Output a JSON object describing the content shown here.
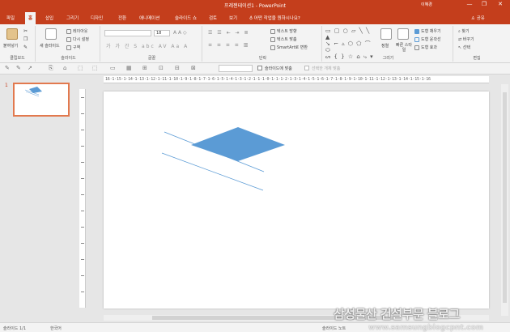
{
  "window": {
    "title": "프레젠테이션1 - PowerPoint",
    "user": "이혜경",
    "minimize": "—",
    "restore": "❐",
    "close": "✕"
  },
  "tabs": [
    "파일",
    "홈",
    "삽입",
    "그리기",
    "디자인",
    "전환",
    "애니메이션",
    "슬라이드 쇼",
    "검토",
    "보기"
  ],
  "active_tab": "홈",
  "tell_me": "어떤 작업을 원하시나요?",
  "share": "공유",
  "ribbon": {
    "clipboard": {
      "paste": "붙여넣기",
      "label": "클립보드"
    },
    "slides": {
      "new_slide": "새 슬라이드",
      "layout": "레이아웃",
      "reset": "다시 설정",
      "section": "구역",
      "label": "슬라이드"
    },
    "font": {
      "font_name": "",
      "font_size": "18",
      "label": "글꼴"
    },
    "paragraph": {
      "text_direction": "텍스트 방향",
      "align_text": "텍스트 맞춤",
      "smartart": "SmartArt로 변환",
      "label": "단락"
    },
    "drawing": {
      "arrange": "정렬",
      "quick_styles": "빠른 스타일",
      "shape_fill": "도형 채우기",
      "shape_outline": "도형 윤곽선",
      "shape_effects": "도형 효과",
      "label": "그리기"
    },
    "editing": {
      "find": "찾기",
      "replace": "바꾸기",
      "select": "선택",
      "label": "편집"
    }
  },
  "qat": {
    "fit_slide": "슬라이드에 맞춤",
    "select_object": "선택한 개체 맞춤"
  },
  "ruler": {
    "horizontal": "16·1·15·1·14·1·13·1·12·1·11·1·10·1·9·1·8·1·7·1·6·1·5·1·4·1·3·1·2·1·1·1·0·1·1·1·2·1·3·1·4·1·5·1·6·1·7·1·8·1·9·1·10·1·11·1·12·1·13·1·14·1·15·1·16"
  },
  "thumbnails": [
    {
      "number": "1"
    }
  ],
  "statusbar": {
    "slide_counter": "슬라이드 1/1",
    "language": "한국어",
    "notes": "슬라이드 노트"
  },
  "watermark": {
    "title": "삼성물산 건설부문 블로그",
    "url": "www.samsungblogcpnt.com"
  },
  "colors": {
    "accent": "#c43e1c",
    "shape_fill": "#5b9bd5",
    "line": "#5b9bd5"
  }
}
